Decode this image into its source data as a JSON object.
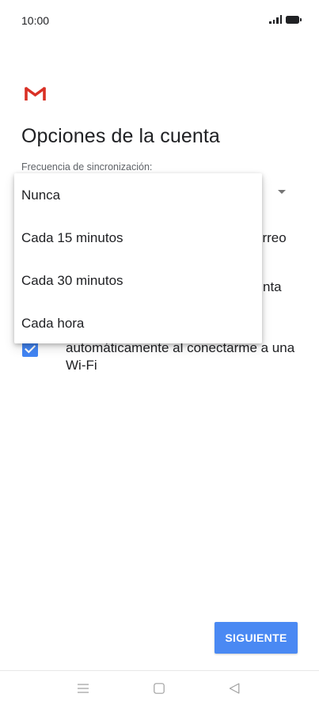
{
  "status_bar": {
    "time": "10:00",
    "icons": [
      "signal-icon",
      "battery-icon"
    ]
  },
  "account_options": {
    "title": "Opciones de la cuenta",
    "sync_label": "Frecuencia de sincronización:",
    "hidden_text_1": "orreo",
    "hidden_text_2": "nta",
    "wifi_checkbox": {
      "checked": true,
      "label": "automáticamente al conectarme a una Wi-Fi"
    }
  },
  "dropdown": {
    "options": [
      {
        "label": "Nunca"
      },
      {
        "label": "Cada 15 minutos"
      },
      {
        "label": "Cada 30 minutos"
      },
      {
        "label": "Cada hora"
      }
    ]
  },
  "footer": {
    "next_label": "SIGUIENTE"
  },
  "nav_bar": {
    "icons": [
      "menu-icon",
      "home-icon",
      "back-icon"
    ]
  },
  "colors": {
    "accent": "#4a89f3",
    "checkbox": "#4285f4",
    "gmail_red": "#d93025"
  }
}
